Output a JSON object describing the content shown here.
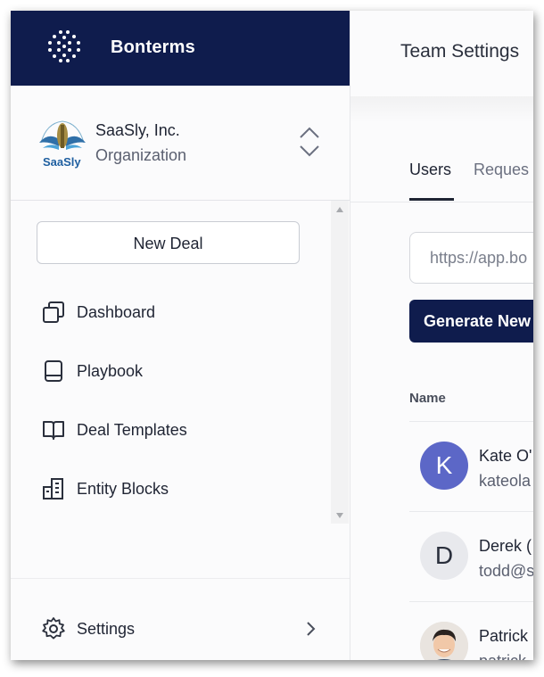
{
  "brand": {
    "name": "Bonterms"
  },
  "org": {
    "name": "SaaSly, Inc.",
    "type": "Organization",
    "logo_text": "SaaSly"
  },
  "sidebar": {
    "new_deal_label": "New Deal",
    "items": [
      {
        "label": "Dashboard",
        "icon": "copy-squares-icon"
      },
      {
        "label": "Playbook",
        "icon": "book-icon"
      },
      {
        "label": "Deal Templates",
        "icon": "open-book-icon"
      },
      {
        "label": "Entity Blocks",
        "icon": "building-icon"
      }
    ],
    "settings_label": "Settings"
  },
  "main": {
    "title": "Team Settings",
    "tabs": [
      {
        "label": "Users",
        "active": true
      },
      {
        "label": "Reques"
      }
    ],
    "invite_input_placeholder": "https://app.bo",
    "generate_button_label": "Generate New",
    "table": {
      "column_name": "Name",
      "rows": [
        {
          "initial": "K",
          "name": "Kate O'",
          "email": "kateola",
          "avatar_color": "#5c67c7"
        },
        {
          "initial": "D",
          "name": "Derek (",
          "email": "todd@s",
          "avatar_color": "#e8e9ed"
        },
        {
          "initial": "",
          "name": "Patrick",
          "email": "patrick",
          "avatar_color": "#f4d3bf"
        }
      ]
    }
  },
  "colors": {
    "navy": "#0f1c4d",
    "accent": "#5c67c7"
  }
}
